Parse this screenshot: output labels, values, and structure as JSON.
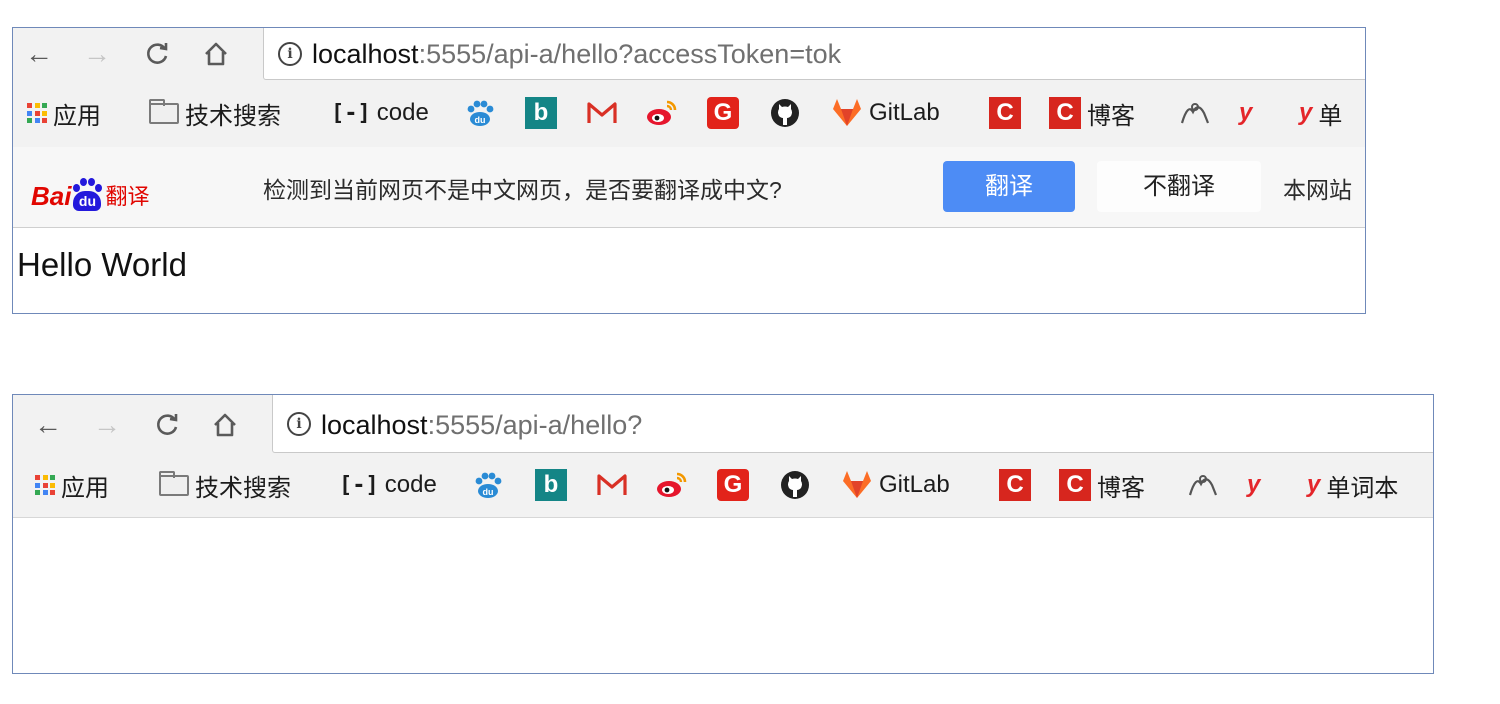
{
  "windows": [
    {
      "nav": {
        "back": "←",
        "forward": "→",
        "reload": "C",
        "home": "⌂"
      },
      "url": {
        "host": "localhost",
        "rest": ":5555/api-a/hello?accessToken=tok"
      },
      "bookmarks": {
        "apps": "应用",
        "tech_search": "技术搜索",
        "code": "code",
        "gitlab": "GitLab",
        "blog": "博客",
        "vocab": "单"
      },
      "translate_bar": {
        "logo_bai": "Bai",
        "logo_du": "du",
        "logo_fanyi": "翻译",
        "question": "检测到当前网页不是中文网页，是否要翻译成中文?",
        "translate_button": "翻译",
        "no_translate_button": "不翻译",
        "this_site": "本网站"
      },
      "content": {
        "text": "Hello World"
      }
    },
    {
      "nav": {
        "back": "←",
        "forward": "→",
        "reload": "C",
        "home": "⌂"
      },
      "url": {
        "host": "localhost",
        "rest": ":5555/api-a/hello?"
      },
      "bookmarks": {
        "apps": "应用",
        "tech_search": "技术搜索",
        "code": "code",
        "gitlab": "GitLab",
        "blog": "博客",
        "vocab": "单词本"
      },
      "content": {
        "text": ""
      }
    }
  ],
  "icons": {
    "baidu_color": "#2a8bd5",
    "bing_color": "#148586",
    "gmail_color": "#d93025",
    "weibo_color": "#e6162d",
    "g_red": "#e2231a",
    "github_color": "#222222",
    "gitlab_orange": "#fc6d26",
    "csdn_red": "#d7261e",
    "youdao_red": "#e4252a",
    "translate_blue": "#4d8cf5"
  }
}
